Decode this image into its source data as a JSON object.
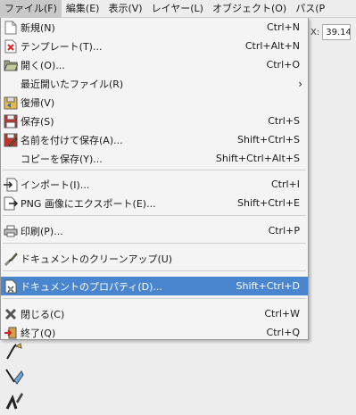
{
  "menubar": {
    "items": [
      "ファイル(F)",
      "編集(E)",
      "表示(V)",
      "レイヤー(L)",
      "オブジェクト(O)",
      "パス(P"
    ]
  },
  "toolbar": {
    "x_label": "X:",
    "x_value": "39.14"
  },
  "file_menu": {
    "items": [
      {
        "label": "新規(N)",
        "shortcut": "Ctrl+N",
        "icon": "new-document-icon"
      },
      {
        "label": "テンプレート(T)...",
        "shortcut": "Ctrl+Alt+N",
        "icon": "template-icon"
      },
      {
        "label": "開く(O)...",
        "shortcut": "Ctrl+O",
        "icon": "open-folder-icon"
      },
      {
        "label": "最近開いたファイル(R)",
        "shortcut": "",
        "icon": "",
        "submenu": true
      },
      {
        "label": "復帰(V)",
        "shortcut": "",
        "icon": "revert-icon"
      },
      {
        "label": "保存(S)",
        "shortcut": "Ctrl+S",
        "icon": "save-icon"
      },
      {
        "label": "名前を付けて保存(A)...",
        "shortcut": "Shift+Ctrl+S",
        "icon": "save-as-icon"
      },
      {
        "label": "コピーを保存(Y)...",
        "shortcut": "Shift+Ctrl+Alt+S",
        "icon": ""
      },
      {
        "label": "インポート(I)...",
        "shortcut": "Ctrl+I",
        "icon": "import-icon"
      },
      {
        "label": "PNG 画像にエクスポート(E)...",
        "shortcut": "Shift+Ctrl+E",
        "icon": "export-icon"
      },
      {
        "label": "印刷(P)...",
        "shortcut": "Ctrl+P",
        "icon": "print-icon"
      },
      {
        "label": "ドキュメントのクリーンアップ(U)",
        "shortcut": "",
        "icon": "cleanup-icon"
      },
      {
        "label": "ドキュメントのプロパティ(D)...",
        "shortcut": "Shift+Ctrl+D",
        "icon": "document-properties-icon",
        "highlighted": true
      },
      {
        "label": "閉じる(C)",
        "shortcut": "Ctrl+W",
        "icon": "close-icon"
      },
      {
        "label": "終了(Q)",
        "shortcut": "Ctrl+Q",
        "icon": "quit-icon"
      }
    ],
    "submenu_arrow": "›"
  },
  "colors": {
    "highlight": "#4a86d0",
    "menu_bg": "#f4f4f4"
  }
}
